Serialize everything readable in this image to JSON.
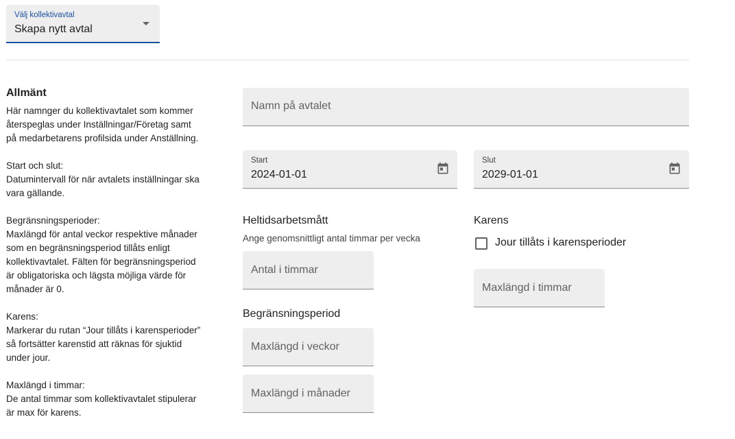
{
  "agreement_select": {
    "label": "Välj kollektivavtal",
    "value": "Skapa nytt avtal"
  },
  "description": {
    "title": "Allmänt",
    "general": "Här namnger du kollektivavtalet som kommer\nåterspeglas under Inställningar/Företag samt\npå medarbetarens profilsida under Anställning.",
    "start_end": "Start och slut:\nDatumintervall för när avtalets inställningar ska\nvara gällande.",
    "limit_periods": "Begränsningsperioder:\nMaxlängd för antal veckor respektive månader\nsom en begränsningsperiod tillåts enligt\nkollektivavtalet. Fälten för begränsningsperiod\när obligatoriska och lägsta möjliga värde för\nmånader är 0.",
    "karens": "Karens:\nMarkerar du rutan “Jour tillåts i karensperioder”\nså fortsätter karenstid att räknas för sjuktid\nunder jour.",
    "max_hours": "Maxlängd i timmar:\nDe antal timmar som kollektivavtalet stipulerar\när max för karens."
  },
  "form": {
    "name_placeholder": "Namn på avtalet",
    "start": {
      "label": "Start",
      "value": "2024-01-01"
    },
    "end": {
      "label": "Slut",
      "value": "2029-01-01"
    },
    "fulltime": {
      "title": "Heltidsarbetsmått",
      "helper": "Ange genomsnittligt antal timmar per vecka",
      "placeholder": "Antal i timmar"
    },
    "karens": {
      "title": "Karens",
      "checkbox_label": "Jour tillåts i karensperioder",
      "checked": false,
      "max_hours_placeholder": "Maxlängd i timmar"
    },
    "limit_period": {
      "title": "Begränsningsperiod",
      "weeks_placeholder": "Maxlängd i veckor",
      "months_placeholder": "Maxlängd i månader"
    }
  },
  "colors": {
    "accent": "#1a4f9c",
    "field_bg": "#eeeeee",
    "underline": "#8a8a8a"
  }
}
